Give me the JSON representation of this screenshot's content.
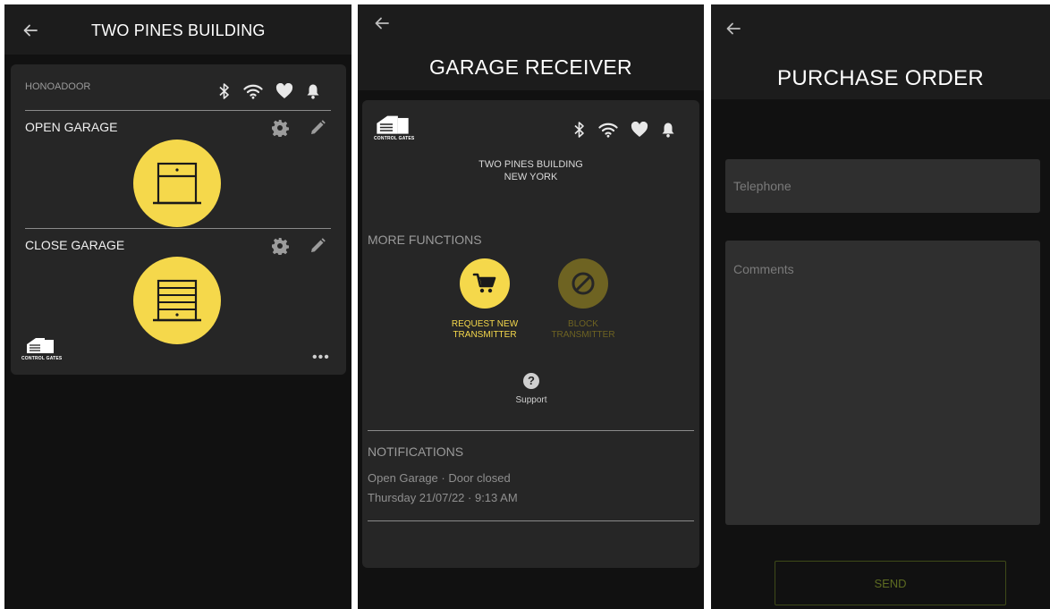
{
  "panel1": {
    "title": "TWO PINES BUILDING",
    "device_name": "HONOADOOR",
    "functions": [
      {
        "label": "OPEN GARAGE"
      },
      {
        "label": "CLOSE GARAGE"
      }
    ],
    "logo_text": "CONTROL GATES",
    "more_label": "•••"
  },
  "panel2": {
    "title": "GARAGE RECEIVER",
    "logo_text": "CONTROL GATES",
    "location_line1": "TWO PINES BUILDING",
    "location_line2": "NEW YORK",
    "more_functions_title": "MORE FUNCTIONS",
    "request_label_line1": "REQUEST NEW",
    "request_label_line2": "TRANSMITTER",
    "block_label_line1": "BLOCK",
    "block_label_line2": "TRANSMITTER",
    "support_icon_glyph": "?",
    "support_label": "Support",
    "notifications_title": "NOTIFICATIONS",
    "notification": {
      "text": "Open Garage · Door closed",
      "time": "Thursday 21/07/22 · 9:13 AM"
    }
  },
  "panel3": {
    "title": "PURCHASE ORDER",
    "telephone_placeholder": "Telephone",
    "comments_placeholder": "Comments",
    "send_label": "SEND"
  },
  "colors": {
    "accent_yellow": "#f5d84b",
    "disabled_olive": "#6e6322",
    "background": "#111111",
    "card": "#262626"
  },
  "icons": [
    "back-arrow-icon",
    "bluetooth-icon",
    "wifi-icon",
    "heart-icon",
    "bell-icon",
    "gear-icon",
    "pencil-icon",
    "garage-door-open-icon",
    "garage-door-closed-icon",
    "cart-icon",
    "block-icon",
    "help-icon"
  ]
}
